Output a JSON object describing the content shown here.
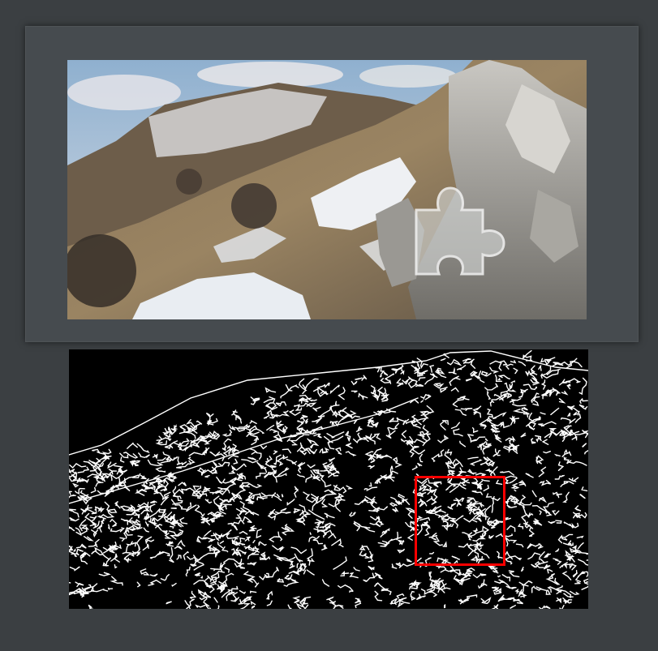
{
  "captcha": {
    "challenge_type": "slider-puzzle",
    "background_image": "snowy-mountain-ridge-photo",
    "piece_icon": "puzzle-piece-icon",
    "edge_map_image": "edge-detection-map",
    "target_marker_color": "#ff0000"
  },
  "colors": {
    "page_background": "#3b3f42",
    "panel_background": "#464b4f",
    "edge_map_background": "#000000",
    "edge_lines": "#ffffff",
    "target_marker": "#ff0000"
  }
}
